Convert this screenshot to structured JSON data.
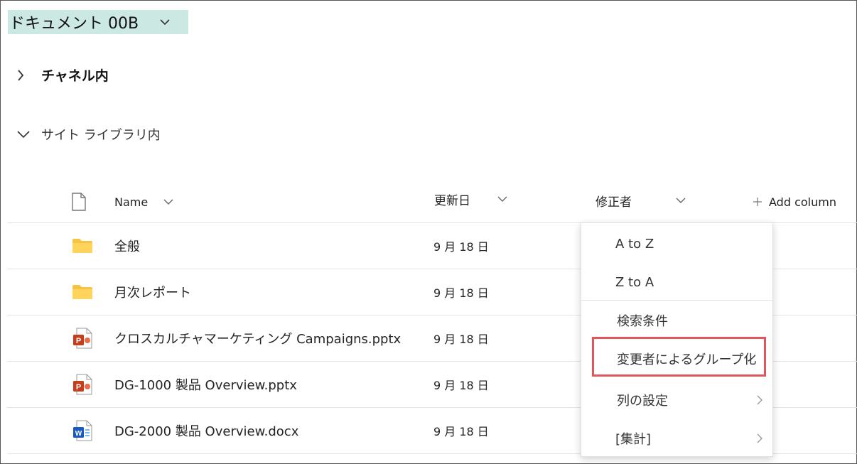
{
  "library": {
    "title": "ドキュメント 00B"
  },
  "sections": [
    {
      "label": "チャネル内",
      "expanded": false
    },
    {
      "label": "サイト ライブラリ内",
      "expanded": true
    }
  ],
  "columns": {
    "name": "Name",
    "modified": "更新日",
    "modified_by": "修正者",
    "add_column": "Add column"
  },
  "files": [
    {
      "name": "全般",
      "modified": "9 月 18 日",
      "icon": "folder-icon"
    },
    {
      "name": "月次レポート",
      "modified": "9 月 18 日",
      "icon": "folder-icon"
    },
    {
      "name": "クロスカルチャマーケティング Campaigns.pptx",
      "modified": "9 月 18 日",
      "icon": "powerpoint-icon"
    },
    {
      "name": "DG-1000 製品 Overview.pptx",
      "modified": "9 月 18 日",
      "icon": "powerpoint-icon"
    },
    {
      "name": "DG-2000 製品 Overview.docx",
      "modified": "9 月 18 日",
      "icon": "word-icon"
    }
  ],
  "column_menu": {
    "sort_a_to_z": "A to Z",
    "sort_z_to_a": "Z to A",
    "filter": "検索条件",
    "group_by": "変更者によるグループ化",
    "column_settings": "列の設定",
    "totals": "[集計]"
  },
  "colors": {
    "title_highlight": "#cce8e2",
    "folder": "#f5c443",
    "powerpoint": "#c43e1c",
    "word": "#185abd",
    "callout": "#e0575b"
  }
}
